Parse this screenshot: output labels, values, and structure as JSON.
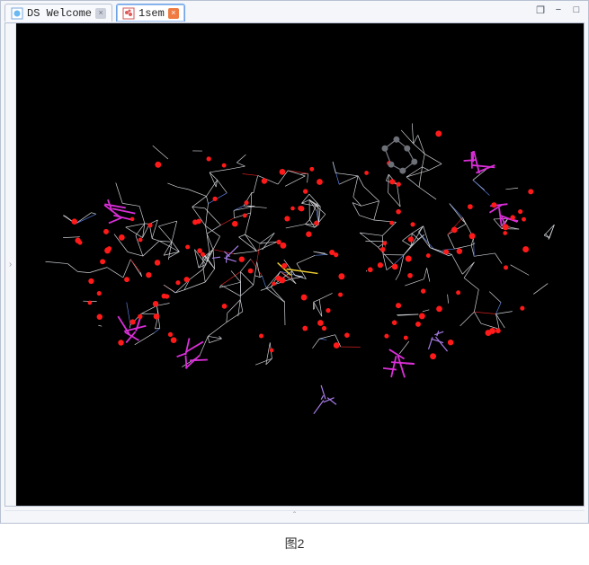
{
  "tabs": [
    {
      "label": "DS Welcome",
      "active": false,
      "icon": "ds-icon"
    },
    {
      "label": "1sem",
      "active": true,
      "icon": "molecule-icon"
    }
  ],
  "window_controls": {
    "restore": "❐",
    "minimize": "−",
    "maximize": "□"
  },
  "caption": "图2",
  "gutters": {
    "left": "›",
    "bottom": "ˆ"
  }
}
